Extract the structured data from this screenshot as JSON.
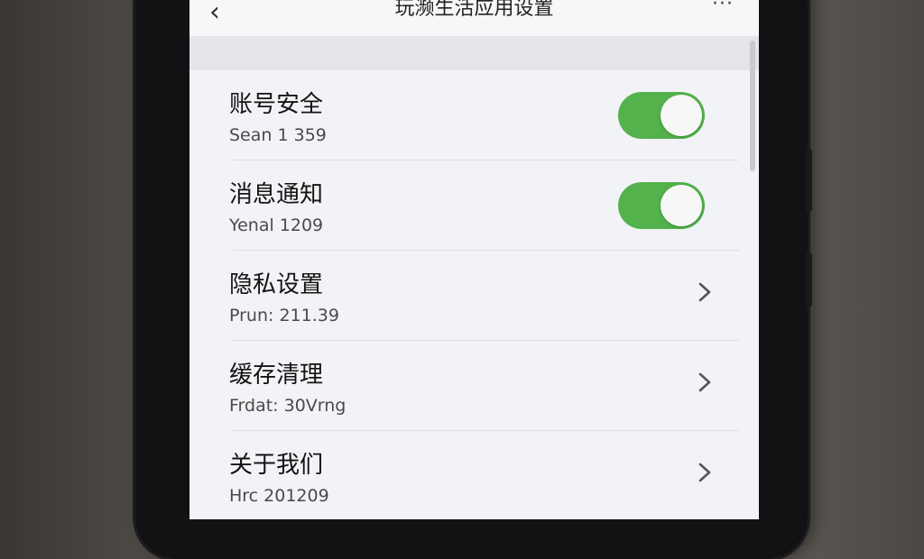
{
  "header": {
    "back_icon": "chevron-left-icon",
    "title": "玩濒生活应用设置",
    "more_icon": "more-dots-icon"
  },
  "settings": [
    {
      "label": "账号安全",
      "sub": "Sean 1 359",
      "control": "toggle",
      "enabled": true
    },
    {
      "label": "消息通知",
      "sub": "Yenal 1209",
      "control": "toggle",
      "enabled": true
    },
    {
      "label": "隐私设置",
      "sub": "Prun: 211.39",
      "control": "chevron"
    },
    {
      "label": "缓存清理",
      "sub": "Frdat: 30Vrng",
      "control": "chevron"
    },
    {
      "label": "关于我们",
      "sub": "Hrc 201209",
      "control": "chevron"
    }
  ],
  "colors": {
    "toggle_on": "#53b24b",
    "screen_bg": "#f2f3f6"
  }
}
